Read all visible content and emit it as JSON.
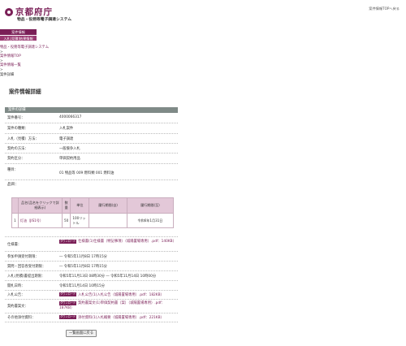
{
  "header": {
    "logo_text": "京都府庁",
    "system_title": "物品・役務等電子調達システム",
    "top_link": "案件情報TOPへ戻る"
  },
  "sidebar": {
    "header": "案件情報",
    "items": [
      {
        "label": "入札|見積|結果情報"
      }
    ]
  },
  "breadcrumb": {
    "items": [
      {
        "label": "物品・役務等電子調達システム"
      },
      {
        "label": "案件情報TOP"
      },
      {
        "label": "案件情報一覧"
      }
    ],
    "separator": ">",
    "current": "案件詳細"
  },
  "page_title": "案件情報詳細",
  "panel_title": "案件の詳細",
  "details": {
    "case_number": {
      "label": "案件番号：",
      "value": "4000066317"
    },
    "case_type": {
      "label": "案件の種類：",
      "value": "入札案件"
    },
    "bid_method": {
      "label": "入札（見積）方法：",
      "value": "電子調達"
    },
    "contract_method": {
      "label": "契約の方法：",
      "value": "一般競争入札"
    },
    "contract_category": {
      "label": "契約区分：",
      "value": "単価契約用品"
    },
    "category": {
      "label": "種目：",
      "value": "01  物品等  009  燃料類  001  燃料油"
    },
    "items_label": "品目："
  },
  "items_table": {
    "headers": [
      "品名(品名をクリックで詳細表示)",
      "数量",
      "単位",
      "履行期間(自)",
      "履行期間(至)"
    ],
    "rows": [
      {
        "no": "1",
        "name": "灯油（JIS1号）",
        "qty": "50",
        "unit": "100リットル",
        "from": "",
        "to": "令和6年1月31日"
      }
    ]
  },
  "spec": {
    "label": "仕様書：",
    "badge": "ダウンロード",
    "file": "仕様書(1)仕様書（特記事項）（城陽置場専用）.pdf：140KB）"
  },
  "deadlines": [
    {
      "label": "参加申請受付期限：",
      "value": "― 令和5年11月8日 17時15分"
    },
    {
      "label": "質問・回答各受付期限：",
      "value": "― 令和5年11月8日 17時15分"
    },
    {
      "label": "入札(見積)書提出期限：",
      "value": "令和5年11月13日 08時30分 ― 令和5年11月14日 10時00分"
    },
    {
      "label": "開札日時：",
      "value": "令和5年11月14日 10時15分"
    }
  ],
  "docs": [
    {
      "label": "入札公告：",
      "badge": "ダウンロード",
      "file": "入札公告(1)入札公告（城陽置場専用）.pdf：182KB）"
    },
    {
      "label": "契約書案文：",
      "badge": "ダウンロード",
      "file": "契約書案文(1)単価契約書（案）（城陽置場専用）.pdf：187KB）"
    },
    {
      "label": "その他添付資料：",
      "badge": "ダウンロード",
      "file": "添付資料(1)入札概要（城陽置場専用）.pdf：221KB）"
    }
  ],
  "back_button": "一覧画面に戻る",
  "colors": {
    "brand": "#7a1f57",
    "panel_header": "#7f8a87",
    "table_header": "#e3c8d8"
  }
}
